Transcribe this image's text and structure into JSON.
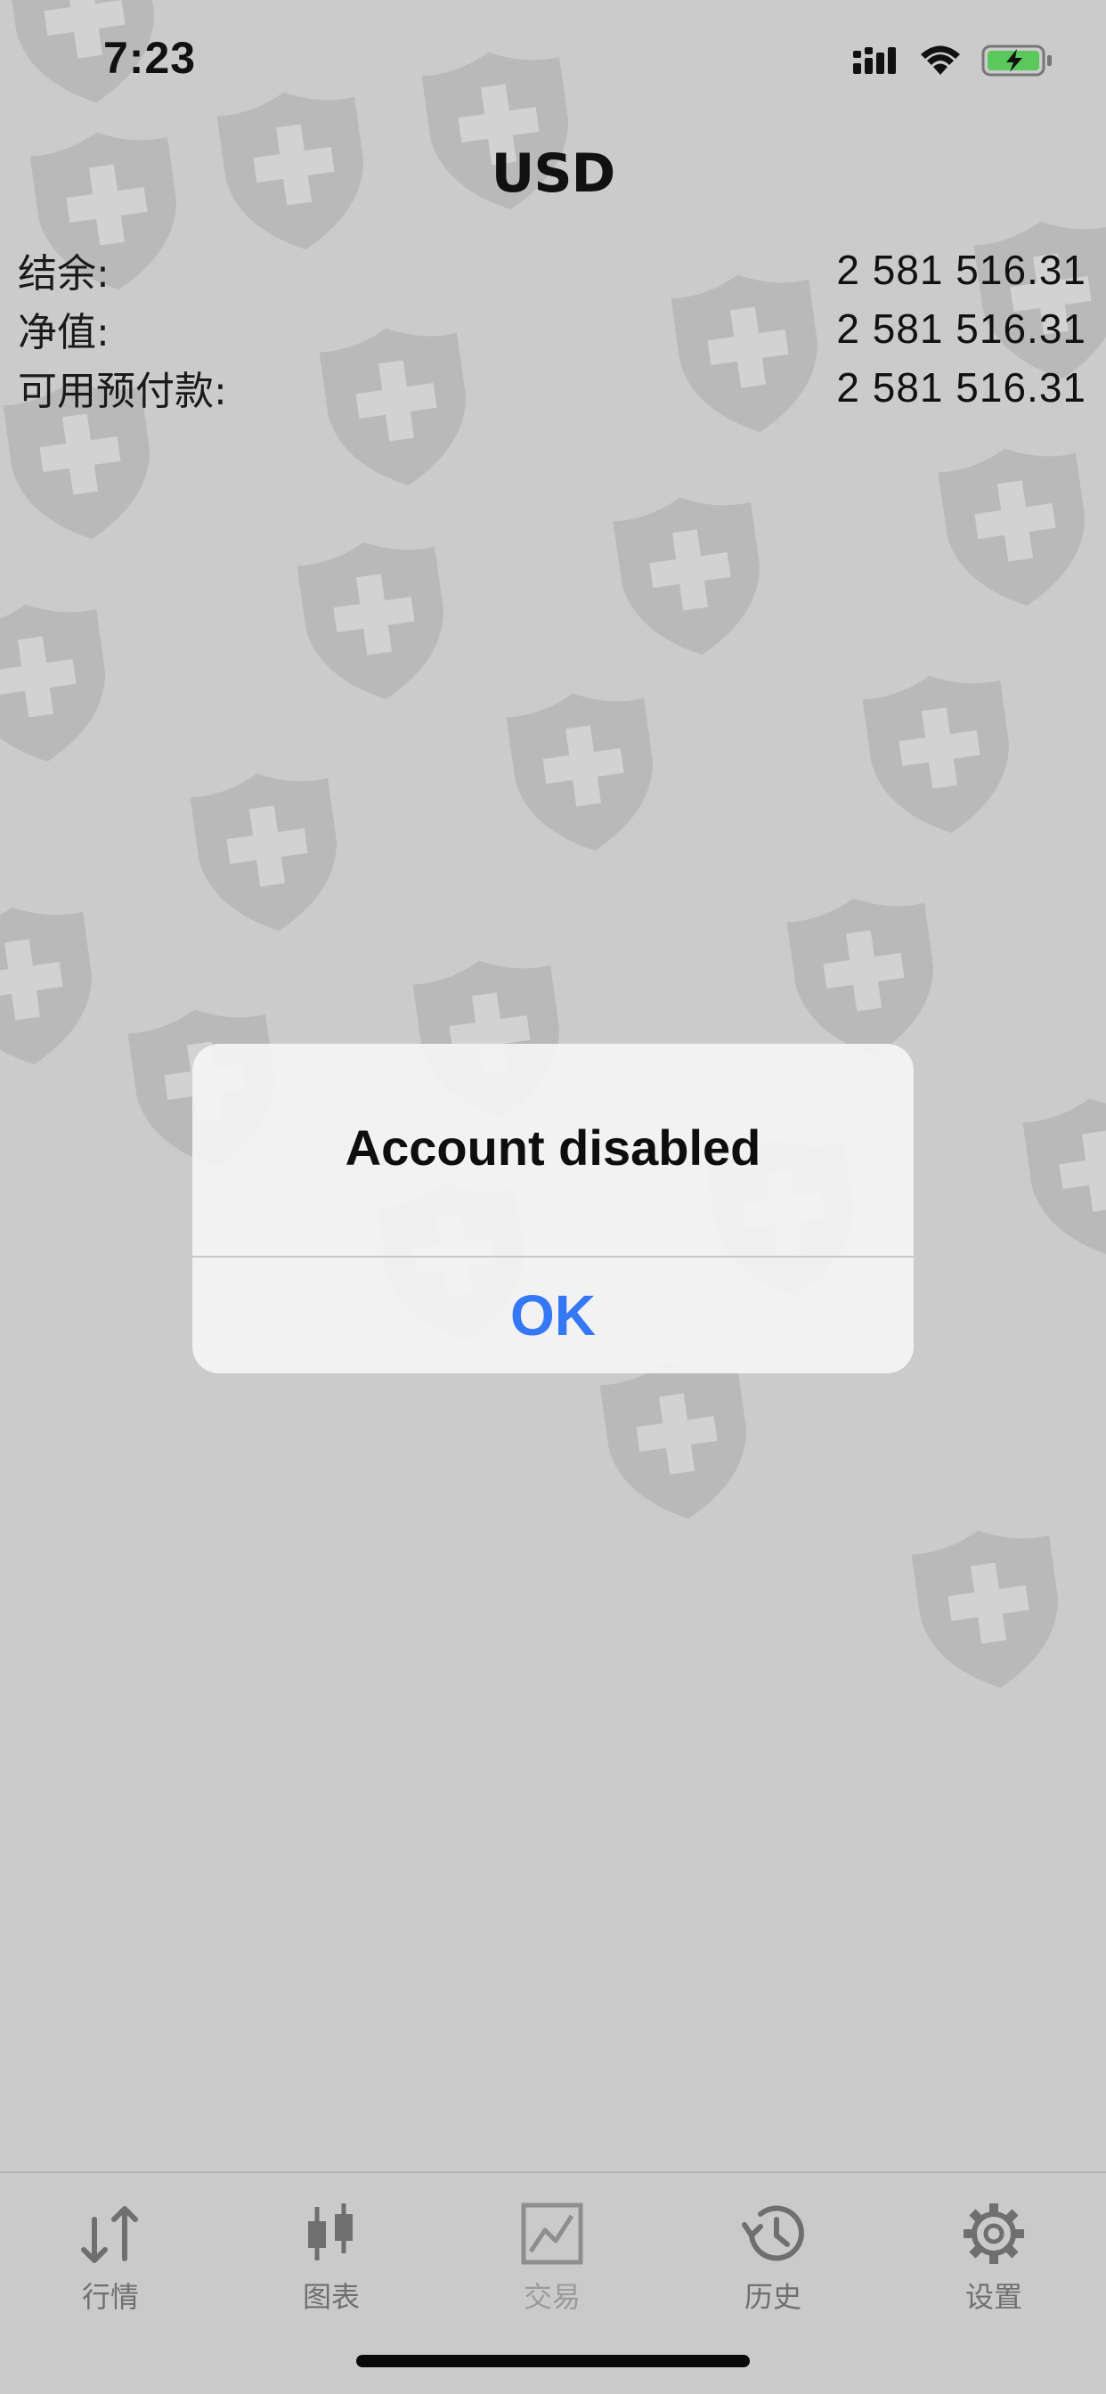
{
  "status_bar": {
    "time": "7:23",
    "battery_color": "#5ac85a"
  },
  "header": {
    "title": "USD"
  },
  "summary": [
    {
      "label": "结余:",
      "value": "2 581 516.31"
    },
    {
      "label": "净值:",
      "value": "2 581 516.31"
    },
    {
      "label": "可用预付款:",
      "value": "2 581 516.31"
    }
  ],
  "alert": {
    "title": "Account disabled",
    "button": "OK",
    "button_color": "#3478f6"
  },
  "tab_bar": {
    "tabs": [
      {
        "label": "行情",
        "icon": "arrows-updown-icon"
      },
      {
        "label": "图表",
        "icon": "candlestick-icon"
      },
      {
        "label": "交易",
        "icon": "trade-chart-icon",
        "active": true
      },
      {
        "label": "历史",
        "icon": "history-clock-icon"
      },
      {
        "label": "设置",
        "icon": "gear-icon"
      }
    ]
  }
}
